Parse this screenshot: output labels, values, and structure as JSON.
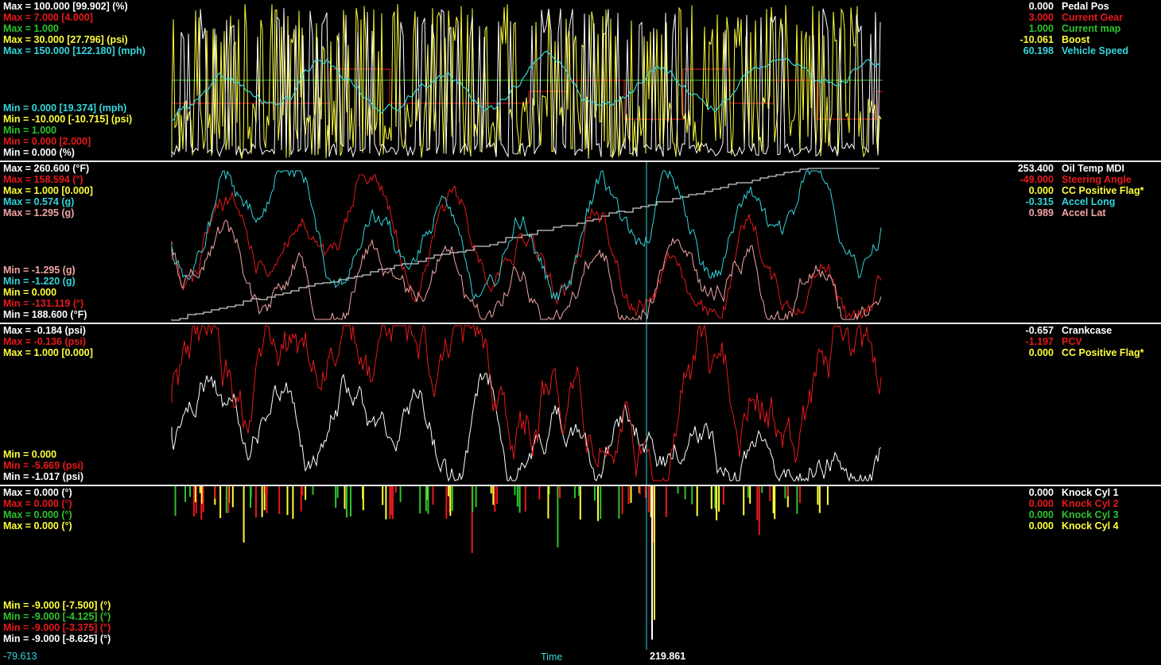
{
  "colors": {
    "white": "#ffffff",
    "red": "#e8191b",
    "green": "#2ec42c",
    "yellow": "#ffff3c",
    "cyan": "#33d6dc",
    "pink": "#f3a6a4"
  },
  "panels": [
    {
      "id": "p1",
      "max_labels": [
        {
          "text": "Max = 100.000 [99.902] (%)",
          "color": "white"
        },
        {
          "text": "Max = 7.000 [4.000]",
          "color": "red"
        },
        {
          "text": "Max = 1.000",
          "color": "green"
        },
        {
          "text": "Max = 30.000 [27.796] (psi)",
          "color": "yellow"
        },
        {
          "text": "Max = 150.000 [122.180] (mph)",
          "color": "cyan"
        }
      ],
      "min_labels": [
        {
          "text": "Min = 0.000 [19.374] (mph)",
          "color": "cyan"
        },
        {
          "text": "Min = -10.000 [-10.715] (psi)",
          "color": "yellow"
        },
        {
          "text": "Min = 1.000",
          "color": "green"
        },
        {
          "text": "Min = 0.000 [2.000]",
          "color": "red"
        },
        {
          "text": "Min = 0.000 (%)",
          "color": "white"
        }
      ],
      "channels": [
        {
          "value": "0.000",
          "name": "Pedal Pos",
          "color": "white"
        },
        {
          "value": "3.000",
          "name": "Current Gear",
          "color": "red"
        },
        {
          "value": "1.000",
          "name": "Current map",
          "color": "green"
        },
        {
          "value": "-10.061",
          "name": "Boost",
          "color": "yellow"
        },
        {
          "value": "60.198",
          "name": "Vehicle Speed",
          "color": "cyan"
        }
      ]
    },
    {
      "id": "p2",
      "max_labels": [
        {
          "text": "Max = 260.600 (°F)",
          "color": "white"
        },
        {
          "text": "Max = 158.594 (°)",
          "color": "red"
        },
        {
          "text": "Max = 1.000 [0.000]",
          "color": "yellow"
        },
        {
          "text": "Max = 0.574 (g)",
          "color": "cyan"
        },
        {
          "text": "Max = 1.295 (g)",
          "color": "pink"
        }
      ],
      "min_labels": [
        {
          "text": "Min = -1.295 (g)",
          "color": "pink"
        },
        {
          "text": "Min = -1.220 (g)",
          "color": "cyan"
        },
        {
          "text": "Min = 0.000",
          "color": "yellow"
        },
        {
          "text": "Min = -131.119 (°)",
          "color": "red"
        },
        {
          "text": "Min = 188.600 (°F)",
          "color": "white"
        }
      ],
      "channels": [
        {
          "value": "253.400",
          "name": "Oil Temp MDI",
          "color": "white"
        },
        {
          "value": "-49.000",
          "name": "Steering Angle",
          "color": "red"
        },
        {
          "value": "0.000",
          "name": "CC Positive Flag*",
          "color": "yellow"
        },
        {
          "value": "-0.315",
          "name": "Accel Long",
          "color": "cyan"
        },
        {
          "value": "0.989",
          "name": "Accel Lat",
          "color": "pink"
        }
      ]
    },
    {
      "id": "p3",
      "max_labels": [
        {
          "text": "Max = -0.184 (psi)",
          "color": "white"
        },
        {
          "text": "Max = -0.136 (psi)",
          "color": "red"
        },
        {
          "text": "Max = 1.000 [0.000]",
          "color": "yellow"
        }
      ],
      "min_labels": [
        {
          "text": "Min = 0.000",
          "color": "yellow"
        },
        {
          "text": "Min = -5.669 (psi)",
          "color": "red"
        },
        {
          "text": "Min = -1.017 (psi)",
          "color": "white"
        }
      ],
      "channels": [
        {
          "value": "-0.657",
          "name": "Crankcase",
          "color": "white"
        },
        {
          "value": "-1.197",
          "name": "PCV",
          "color": "red"
        },
        {
          "value": "0.000",
          "name": "CC Positive Flag*",
          "color": "yellow"
        }
      ]
    },
    {
      "id": "p4",
      "max_labels": [
        {
          "text": "Max = 0.000 (°)",
          "color": "white"
        },
        {
          "text": "Max = 0.000 (°)",
          "color": "red"
        },
        {
          "text": "Max = 0.000 (°)",
          "color": "green"
        },
        {
          "text": "Max = 0.000 (°)",
          "color": "yellow"
        }
      ],
      "min_labels": [
        {
          "text": "Min = -9.000 [-7.500] (°)",
          "color": "yellow"
        },
        {
          "text": "Min = -9.000 [-4.125] (°)",
          "color": "green"
        },
        {
          "text": "Min = -9.000 [-3.375] (°)",
          "color": "red"
        },
        {
          "text": "Min = -9.000 [-8.625] (°)",
          "color": "white"
        }
      ],
      "channels": [
        {
          "value": "0.000",
          "name": "Knock Cyl 1",
          "color": "white"
        },
        {
          "value": "0.000",
          "name": "Knock Cyl 2",
          "color": "red"
        },
        {
          "value": "0.000",
          "name": "Knock Cyl 3",
          "color": "green"
        },
        {
          "value": "0.000",
          "name": "Knock Cyl 4",
          "color": "yellow"
        }
      ]
    }
  ],
  "time_axis": {
    "start": "-79.613",
    "label": "Time",
    "cursor": "219.861"
  }
}
